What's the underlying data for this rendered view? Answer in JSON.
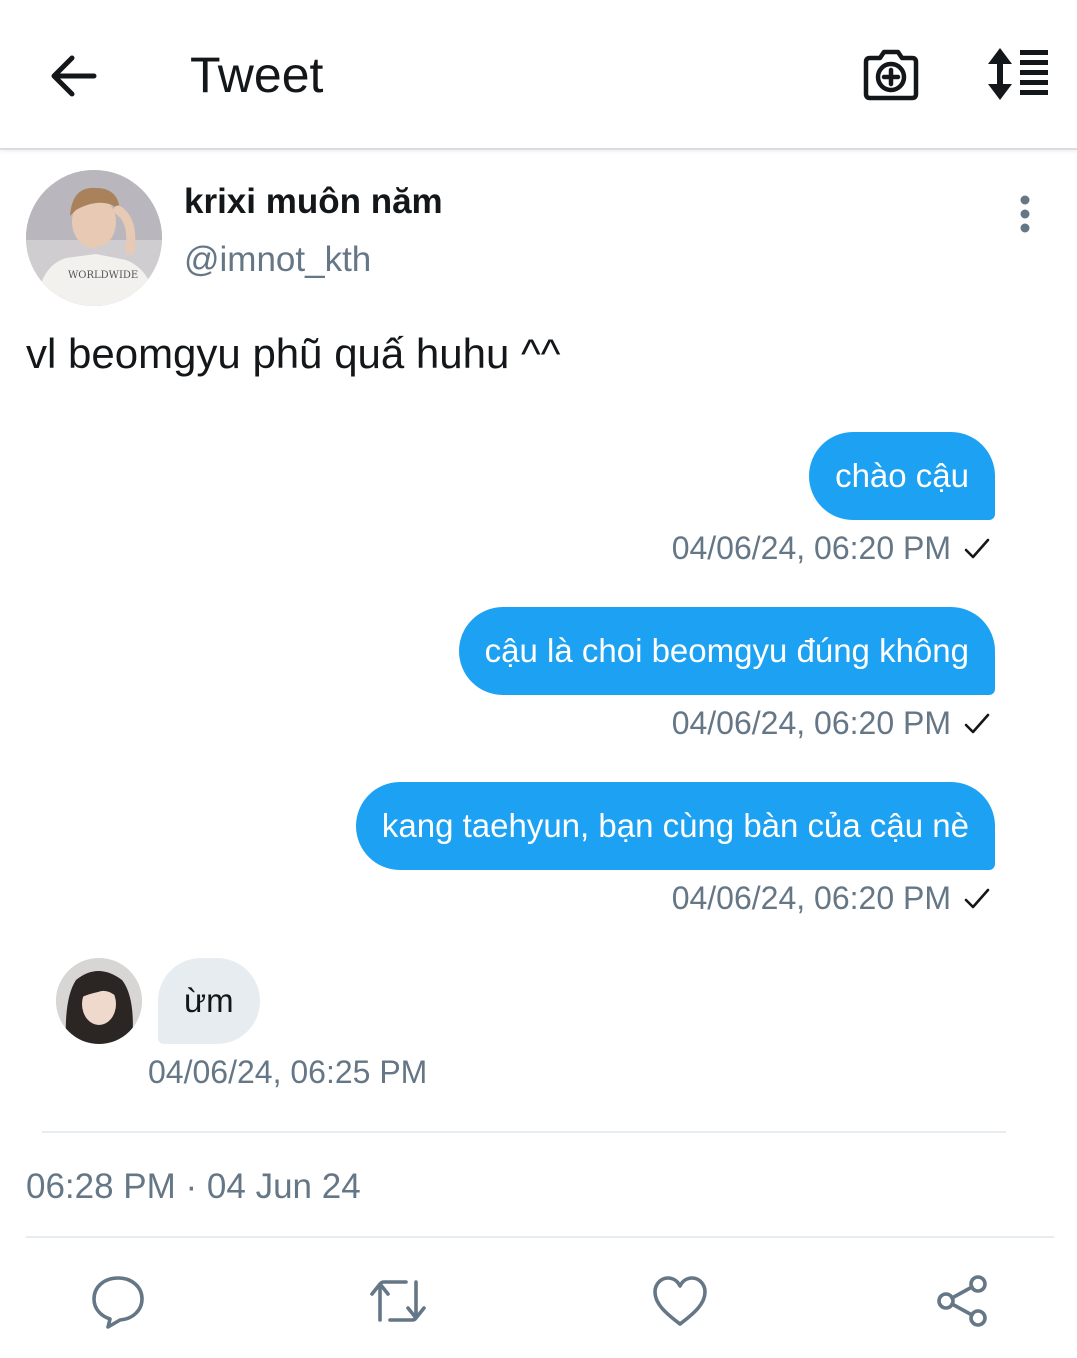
{
  "header": {
    "title": "Tweet",
    "back_icon": "arrow-left-icon",
    "camera_icon": "camera-plus-icon",
    "sort_icon": "sort-list-icon"
  },
  "tweet": {
    "display_name": "krixi muôn năm",
    "handle": "@imnot_kth",
    "text": "vl beomgyu phũ quấ huhu ^^",
    "timestamp": "06:28 PM · 04 Jun 24"
  },
  "messages": [
    {
      "direction": "outgoing",
      "text": "chào cậu",
      "time": "04/06/24, 06:20 PM",
      "read": true
    },
    {
      "direction": "outgoing",
      "text": "cậu là choi beomgyu đúng không",
      "time": "04/06/24, 06:20 PM",
      "read": true
    },
    {
      "direction": "outgoing",
      "text": "kang taehyun, bạn cùng bàn của cậu nè",
      "time": "04/06/24, 06:20 PM",
      "read": true
    },
    {
      "direction": "incoming",
      "text": "ừm",
      "time": "04/06/24, 06:25 PM"
    }
  ],
  "actions": [
    "reply-icon",
    "retweet-icon",
    "like-icon",
    "share-icon"
  ],
  "colors": {
    "accent": "#1da1f2",
    "secondary_text": "#657786",
    "incoming_bubble": "#e6ecf0"
  }
}
